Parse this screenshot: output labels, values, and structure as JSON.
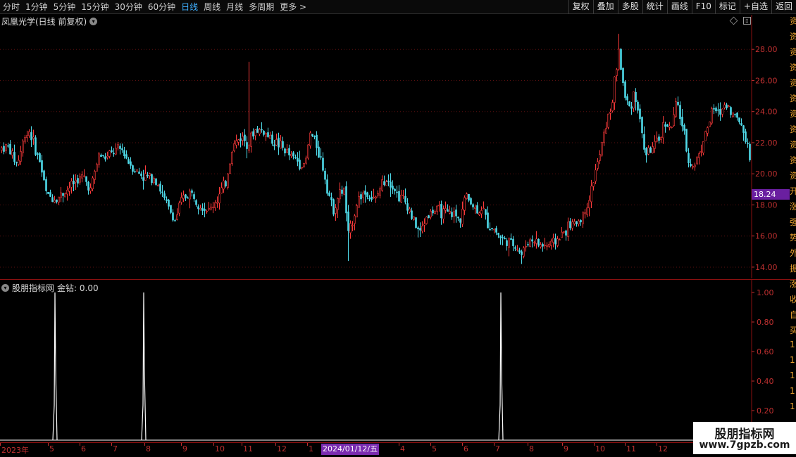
{
  "toolbar": {
    "periods": [
      {
        "label": "分时",
        "active": false
      },
      {
        "label": "1分钟",
        "active": false
      },
      {
        "label": "5分钟",
        "active": false
      },
      {
        "label": "15分钟",
        "active": false
      },
      {
        "label": "30分钟",
        "active": false
      },
      {
        "label": "60分钟",
        "active": false
      },
      {
        "label": "日线",
        "active": true
      },
      {
        "label": "周线",
        "active": false
      },
      {
        "label": "月线",
        "active": false
      },
      {
        "label": "多周期",
        "active": false
      },
      {
        "label": "更多 >",
        "active": false
      }
    ],
    "actions": [
      "复权",
      "叠加",
      "多股",
      "统计",
      "画线",
      "F10",
      "标记",
      "+自选",
      "返回"
    ]
  },
  "main_chart": {
    "title": "凤凰光学(日线 前复权)",
    "last_price": "18.24",
    "y_ticks": [
      "28.00",
      "26.00",
      "24.00",
      "22.00",
      "20.00",
      "18.00",
      "16.00",
      "14.00"
    ],
    "colors": {
      "up": "#ff3b3b",
      "down": "#4fd9e8",
      "grid": "#5a1010",
      "axis": "#c03030"
    }
  },
  "indicator": {
    "title": "股朋指标网",
    "series_label": "金钻: 0.00",
    "y_ticks": [
      "1.00",
      "0.80",
      "0.60",
      "0.40",
      "0.20"
    ]
  },
  "date_axis": {
    "ticks": [
      "2023年",
      "5",
      "6",
      "7",
      "8",
      "9",
      "10",
      "11",
      "12",
      "1",
      "4",
      "5",
      "6",
      "7",
      "8",
      "9",
      "10",
      "11",
      "12"
    ],
    "cursor_date": "2024/01/12/五"
  },
  "right_strip": [
    "资",
    "资",
    "资",
    "资",
    "资",
    "资",
    "资",
    "资",
    "资",
    "资",
    "资",
    "开",
    "涨",
    "强",
    "势",
    "外",
    "振",
    "涨",
    "收",
    "自",
    "买",
    "1",
    "1",
    "1",
    "1",
    "1"
  ],
  "watermark": {
    "title": "股朋指标网",
    "url": "www.7gpzb.com"
  },
  "chart_data": {
    "type": "candlestick",
    "ylim": [
      13.5,
      29.5
    ],
    "trend": [
      [
        0,
        21.6
      ],
      [
        10,
        21.8
      ],
      [
        24,
        20.6
      ],
      [
        35,
        22.5
      ],
      [
        42,
        22.8
      ],
      [
        48,
        21.8
      ],
      [
        56,
        20.8
      ],
      [
        66,
        18.6
      ],
      [
        80,
        18.4
      ],
      [
        95,
        19.0
      ],
      [
        108,
        19.6
      ],
      [
        118,
        19.8
      ],
      [
        128,
        19.0
      ],
      [
        140,
        21.2
      ],
      [
        150,
        21.0
      ],
      [
        160,
        21.4
      ],
      [
        172,
        21.6
      ],
      [
        182,
        20.8
      ],
      [
        192,
        20.2
      ],
      [
        205,
        19.8
      ],
      [
        220,
        19.8
      ],
      [
        232,
        18.4
      ],
      [
        248,
        17.0
      ],
      [
        258,
        18.4
      ],
      [
        270,
        18.8
      ],
      [
        285,
        18.0
      ],
      [
        296,
        17.6
      ],
      [
        308,
        18.4
      ],
      [
        320,
        19.4
      ],
      [
        330,
        21.8
      ],
      [
        342,
        22.4
      ],
      [
        352,
        22.0
      ],
      [
        362,
        22.8
      ],
      [
        372,
        22.8
      ],
      [
        385,
        22.2
      ],
      [
        398,
        21.8
      ],
      [
        410,
        21.2
      ],
      [
        424,
        20.8
      ],
      [
        432,
        20.4
      ],
      [
        440,
        22.6
      ],
      [
        448,
        22.0
      ],
      [
        456,
        20.8
      ],
      [
        464,
        19.2
      ],
      [
        472,
        17.6
      ],
      [
        480,
        18.6
      ],
      [
        488,
        19.0
      ],
      [
        494,
        16.0
      ],
      [
        500,
        17.0
      ],
      [
        508,
        18.4
      ],
      [
        516,
        18.8
      ],
      [
        524,
        18.6
      ],
      [
        532,
        18.2
      ],
      [
        540,
        19.2
      ],
      [
        548,
        19.8
      ],
      [
        556,
        19.4
      ],
      [
        564,
        18.6
      ],
      [
        572,
        18.4
      ],
      [
        580,
        17.8
      ],
      [
        588,
        16.8
      ],
      [
        596,
        16.2
      ],
      [
        604,
        17.2
      ],
      [
        614,
        17.6
      ],
      [
        624,
        17.6
      ],
      [
        634,
        17.4
      ],
      [
        644,
        17.4
      ],
      [
        652,
        17.0
      ],
      [
        660,
        18.6
      ],
      [
        668,
        18.2
      ],
      [
        676,
        17.6
      ],
      [
        684,
        17.8
      ],
      [
        692,
        16.8
      ],
      [
        702,
        16.4
      ],
      [
        712,
        15.8
      ],
      [
        722,
        15.6
      ],
      [
        732,
        15.4
      ],
      [
        740,
        14.8
      ],
      [
        748,
        15.6
      ],
      [
        756,
        15.8
      ],
      [
        766,
        15.4
      ],
      [
        776,
        15.4
      ],
      [
        786,
        15.6
      ],
      [
        796,
        16.0
      ],
      [
        806,
        16.6
      ],
      [
        816,
        16.8
      ],
      [
        826,
        17.2
      ],
      [
        836,
        18.4
      ],
      [
        844,
        20.0
      ],
      [
        852,
        21.4
      ],
      [
        860,
        23.2
      ],
      [
        868,
        24.4
      ],
      [
        874,
        26.6
      ],
      [
        878,
        28.0
      ],
      [
        886,
        25.0
      ],
      [
        894,
        24.2
      ],
      [
        900,
        25.4
      ],
      [
        908,
        23.4
      ],
      [
        916,
        21.2
      ],
      [
        924,
        21.6
      ],
      [
        934,
        22.0
      ],
      [
        944,
        23.4
      ],
      [
        952,
        22.8
      ],
      [
        960,
        24.6
      ],
      [
        968,
        23.2
      ],
      [
        976,
        21.0
      ],
      [
        984,
        20.4
      ],
      [
        994,
        21.6
      ],
      [
        1004,
        23.0
      ],
      [
        1012,
        24.2
      ],
      [
        1020,
        23.8
      ],
      [
        1030,
        24.6
      ],
      [
        1040,
        23.8
      ],
      [
        1050,
        23.4
      ],
      [
        1058,
        22.4
      ],
      [
        1064,
        21.0
      ],
      [
        1068,
        21.6
      ]
    ],
    "spikes": [
      {
        "x": 354,
        "high": 27.2
      },
      {
        "x": 494,
        "low": 14.4
      },
      {
        "x": 878,
        "high": 29.0
      },
      {
        "x": 740,
        "low": 14.2
      }
    ],
    "indicator_signals": [
      {
        "date_near": "5",
        "value": 1.0
      },
      {
        "date_near": "8",
        "value": 1.0
      },
      {
        "date_near": "7",
        "value": 1.0
      }
    ]
  }
}
